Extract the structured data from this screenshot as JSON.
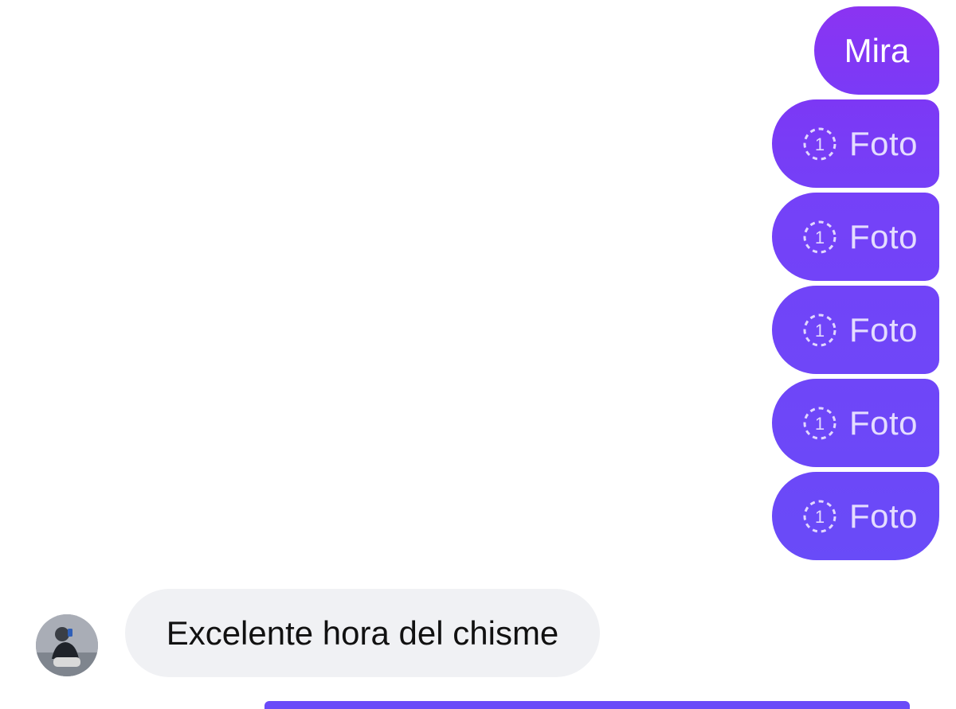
{
  "thread": {
    "sent_messages": [
      {
        "type": "text",
        "text": "Mira"
      },
      {
        "type": "view-once-photo",
        "icon": "view-once-1-icon",
        "label": "Foto"
      },
      {
        "type": "view-once-photo",
        "icon": "view-once-1-icon",
        "label": "Foto"
      },
      {
        "type": "view-once-photo",
        "icon": "view-once-1-icon",
        "label": "Foto"
      },
      {
        "type": "view-once-photo",
        "icon": "view-once-1-icon",
        "label": "Foto"
      },
      {
        "type": "view-once-photo",
        "icon": "view-once-1-icon",
        "label": "Foto"
      }
    ],
    "received_messages": [
      {
        "type": "text",
        "text": "Excelente hora del chisme",
        "sender_avatar": "avatar"
      }
    ]
  },
  "view_once_icon_digit": "1",
  "colors": {
    "sent_bubble_top": "#8b34f2",
    "sent_bubble_bottom": "#694bf8",
    "received_bubble": "#f0f1f4",
    "received_text": "#111111",
    "view_once_text": "#e2d7ff"
  }
}
